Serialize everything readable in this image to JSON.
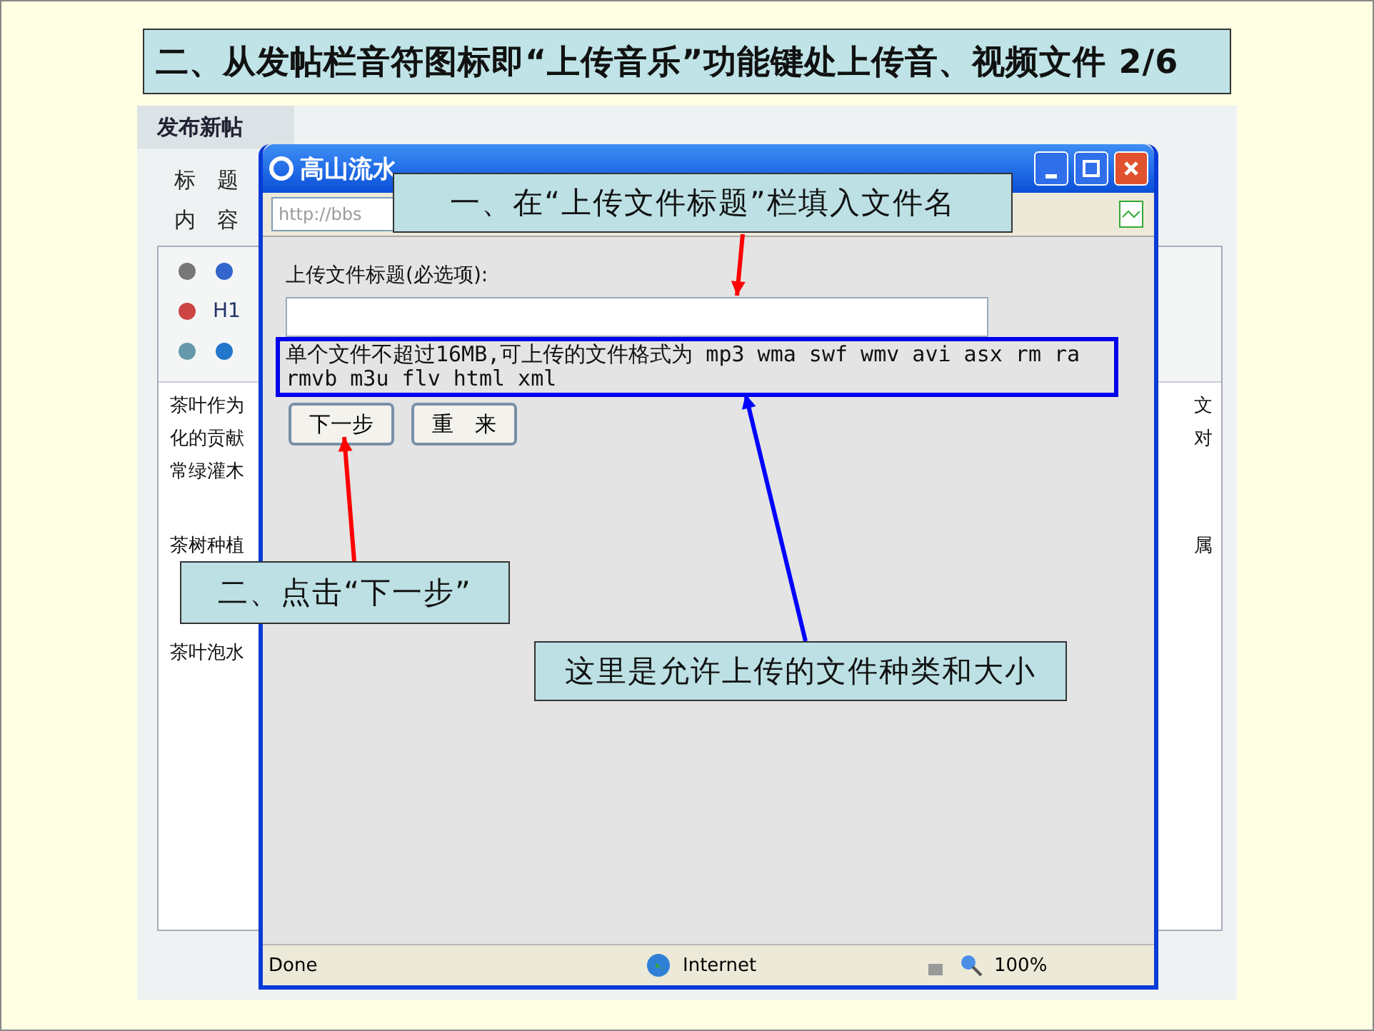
{
  "slide_title": "二、从发帖栏音符图标即“上传音乐”功能键处上传音、视频文件 2/6",
  "page": {
    "header": "发布新帖",
    "labels": [
      "标　题",
      "内　容"
    ],
    "toolbar_text": "H1",
    "editor_paragraphs": [
      [
        "茶叶作为",
        "化的贡献",
        "常绿灌木"
      ],
      [
        "茶树种植"
      ],
      [
        "茶叶泡水"
      ]
    ],
    "right_fragments": [
      [
        "文",
        "对"
      ],
      [
        "属"
      ]
    ]
  },
  "popup": {
    "title": "高山流水",
    "address": "http://bbs",
    "field_label": "上传文件标题(必选项):",
    "note": "单个文件不超过16MB,可上传的文件格式为 mp3 wma swf wmv avi asx rm ra rmvb m3u flv html xml",
    "buttons": [
      "下一步",
      "重　来"
    ],
    "status": {
      "text": "Done",
      "zone": "Internet",
      "zoom": "100%"
    }
  },
  "callouts": [
    {
      "text": "一、在“上传文件标题”栏填入文件名",
      "color": "#ff0000"
    },
    {
      "text": "二、点击“下一步”",
      "color": "#ff0000"
    },
    {
      "text": "这里是允许上传的文件种类和大小",
      "color": "#0000ff"
    }
  ]
}
